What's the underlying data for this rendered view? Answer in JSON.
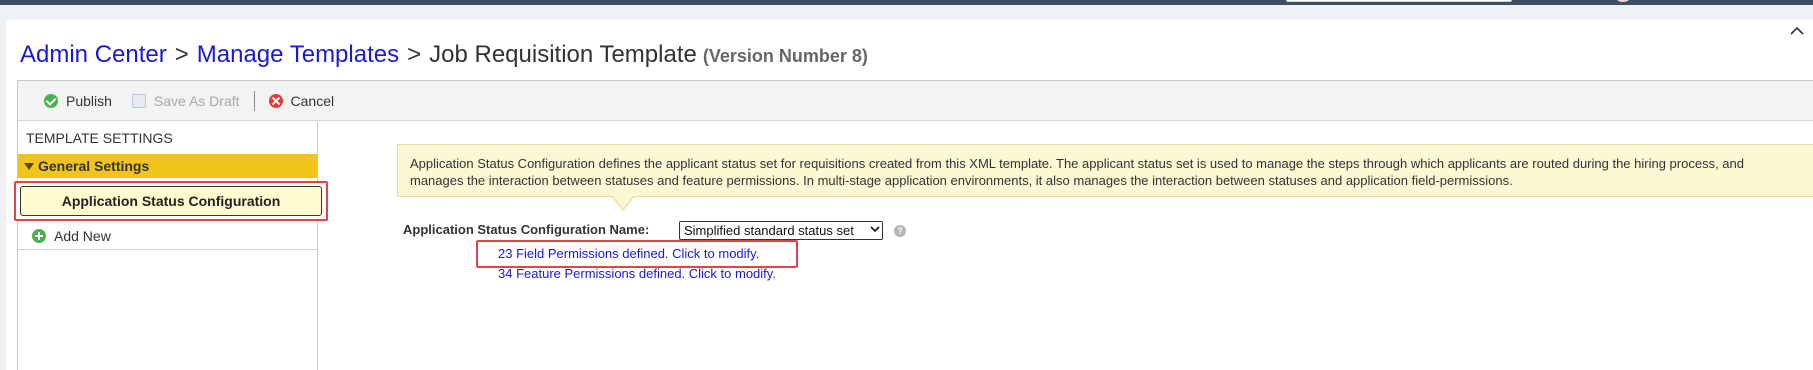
{
  "breadcrumb": {
    "admin_center": "Admin Center",
    "separator": ">",
    "manage_templates": "Manage Templates",
    "current": "Job Requisition Template",
    "version": "(Version Number 8)"
  },
  "header": {
    "collapse_glyph": "^"
  },
  "toolbar": {
    "publish_label": "Publish",
    "save_draft_label": "Save As Draft",
    "cancel_label": "Cancel"
  },
  "sidebar": {
    "heading": "TEMPLATE SETTINGS",
    "section_label": "General Settings",
    "selected_item": "Application Status Configuration",
    "add_new_label": "Add New"
  },
  "main": {
    "info_text": "Application Status Configuration defines the applicant status set for requisitions created from this XML template. The applicant status set is used to manage the steps through which applicants are routed during the hiring process, and manages the interaction between statuses and feature permissions. In multi-stage application environments, it also manages the interaction between statuses and application field-permissions.",
    "config_label": "Application Status Configuration Name:",
    "config_value": "Simplified standard status set",
    "help_glyph": "?",
    "field_permissions_link": "23 Field Permissions defined. Click to modify.",
    "feature_permissions_link": "34 Feature Permissions defined. Click to modify."
  },
  "icons": {
    "publish": "check-circle-icon",
    "save_draft": "document-icon",
    "cancel": "x-circle-icon",
    "add_new": "plus-circle-icon",
    "section": "triangle-down-icon",
    "help": "question-icon"
  },
  "colors": {
    "link": "#1a1ad6",
    "section_bg": "#f0c419",
    "info_bg": "#fdf8d4",
    "highlight": "#e04444"
  }
}
